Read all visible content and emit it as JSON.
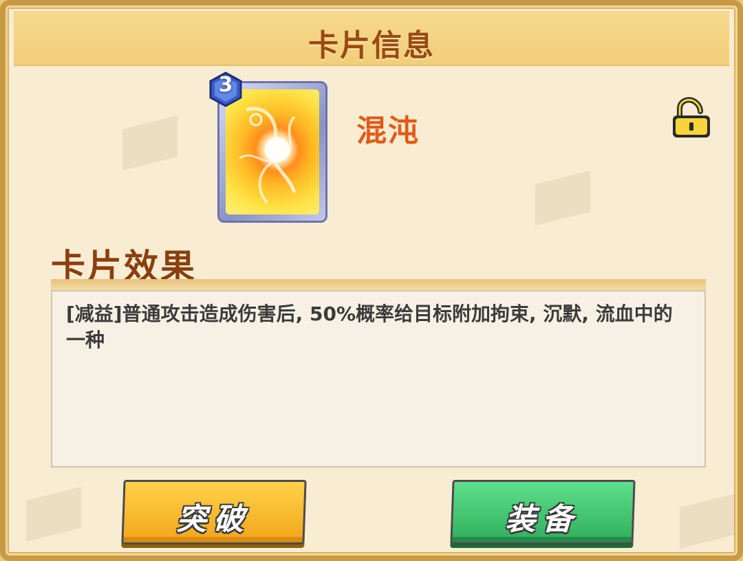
{
  "dialog": {
    "title": "卡片信息"
  },
  "card": {
    "level": "3",
    "name": "混沌",
    "art_icon": "chaos-swirl-icon",
    "lock_icon": "unlocked-padlock-icon"
  },
  "effect": {
    "section_title": "卡片效果",
    "description": "[减益]普通攻击造成伤害后, 50%概率给目标附加拘束, 沉默, 流血中的一种"
  },
  "buttons": {
    "breakthrough_label": "突破",
    "equip_label": "装备"
  },
  "colors": {
    "frame": "#c89a46",
    "panel_bg": "#f8ecd2",
    "title_text": "#9a4a12",
    "card_name": "#e25a18",
    "break_button": "#f2a51a",
    "equip_button": "#2fae5d"
  }
}
